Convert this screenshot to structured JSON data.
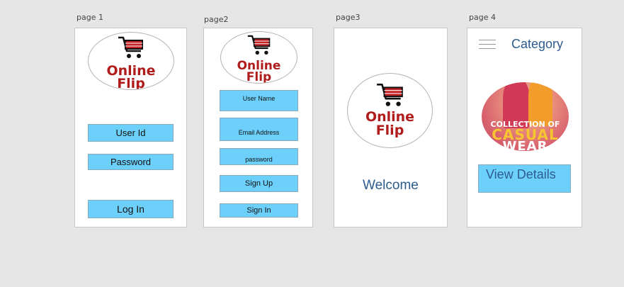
{
  "pages": {
    "page1": {
      "label": "page 1",
      "logo": {
        "line1": "Online",
        "line2": "Flip"
      },
      "user_id": "User Id",
      "password": "Password",
      "login": "Log In"
    },
    "page2": {
      "label": "page2",
      "logo": {
        "line1": "Online",
        "line2": "Flip"
      },
      "user_name": "User Name",
      "email": "Email Address",
      "password": "password",
      "sign_up": "Sign Up",
      "sign_in": "Sign In"
    },
    "page3": {
      "label": "page3",
      "logo": {
        "line1": "Online",
        "line2": "Flip"
      },
      "welcome": "Welcome"
    },
    "page4": {
      "label": "page 4",
      "menu_icon": "hamburger-menu-icon",
      "title": "Category",
      "promo": {
        "line1": "COLLECTION OF",
        "line2": "CASUAL",
        "line3": "WEAR"
      },
      "view_details": "View Details"
    }
  },
  "colors": {
    "button_fill": "#6dd0fa",
    "brand_red": "#b01c1c",
    "heading_blue": "#2d5d8e",
    "canvas": "#e6e6e6"
  },
  "icons": [
    "shopping-cart-icon",
    "hamburger-menu-icon"
  ]
}
